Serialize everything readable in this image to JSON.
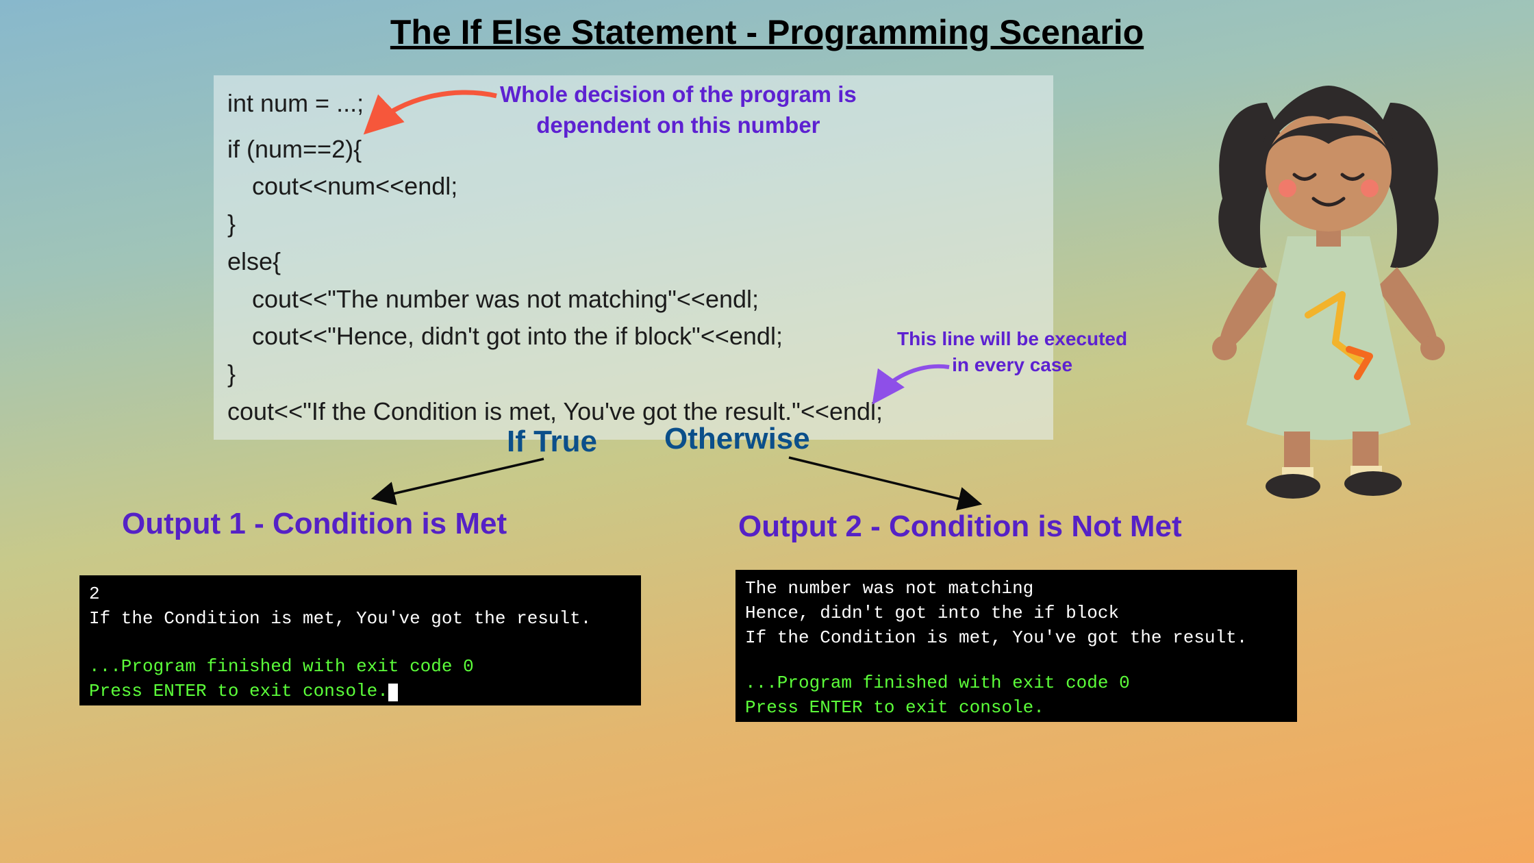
{
  "title": "The If Else Statement - Programming Scenario",
  "code": {
    "l1": "int num = ...;",
    "l2": "if (num==2){",
    "l3": "cout<<num<<endl;",
    "l4": "}",
    "l5": "else{",
    "l6": "cout<<\"The number was not matching\"<<endl;",
    "l7": "cout<<\"Hence, didn't got into the if block\"<<endl;",
    "l8": "}",
    "l9": "cout<<\"If the Condition is met, You've got the result.\"<<endl;"
  },
  "annotations": {
    "decision_l1": "Whole decision of the program is",
    "decision_l2": "dependent on this number",
    "always_l1": "This line will be executed",
    "always_l2": "in every case"
  },
  "branches": {
    "true": "If True",
    "false": "Otherwise"
  },
  "outputs": {
    "o1_title": "Output 1 - Condition is Met",
    "o2_title": "Output 2 - Condition is Not Met",
    "o1": {
      "l1": "2",
      "l2": "If the Condition is met, You've got the result.",
      "p1": "...Program finished with exit code 0",
      "p2": "Press ENTER to exit console."
    },
    "o2": {
      "l1": "The number was not matching",
      "l2": "Hence, didn't got into the if block",
      "l3": "If the Condition is met, You've got the result.",
      "p1": "...Program finished with exit code 0",
      "p2": "Press ENTER to exit console."
    }
  }
}
